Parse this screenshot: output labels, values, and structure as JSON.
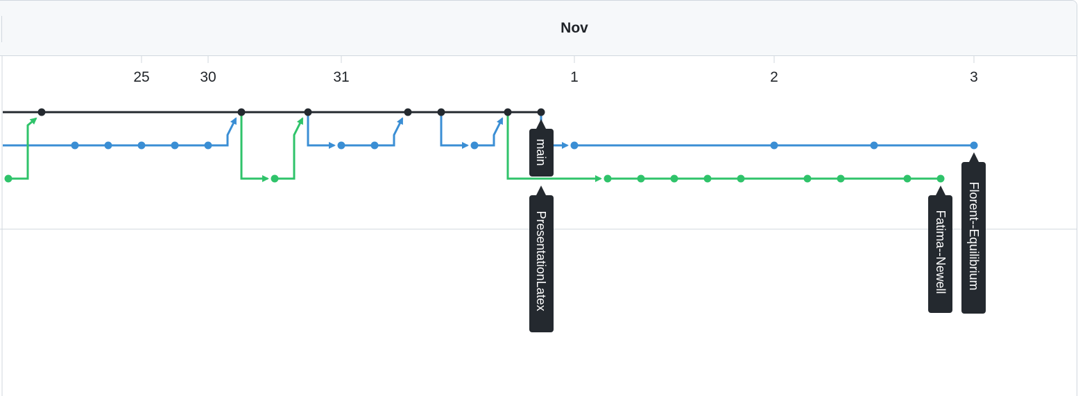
{
  "header": {
    "month": "Nov"
  },
  "timeline": {
    "days": [
      "25",
      "30",
      "31",
      "1",
      "2",
      "3"
    ]
  },
  "branches": [
    {
      "name": "main",
      "color": "#24292f"
    },
    {
      "name": "Florent--Equilibrium",
      "color": "#3a8ed4"
    },
    {
      "name": "Fatima--Newell",
      "color": "#2fc36a"
    }
  ],
  "refs": [
    "main",
    "PresentationLatex",
    "Fatima--Newell",
    "Florent--Equilibrium"
  ],
  "colors": {
    "main": "#24292f",
    "blue": "#3a8ed4",
    "green": "#2fc36a",
    "label_bg": "#24292f"
  }
}
